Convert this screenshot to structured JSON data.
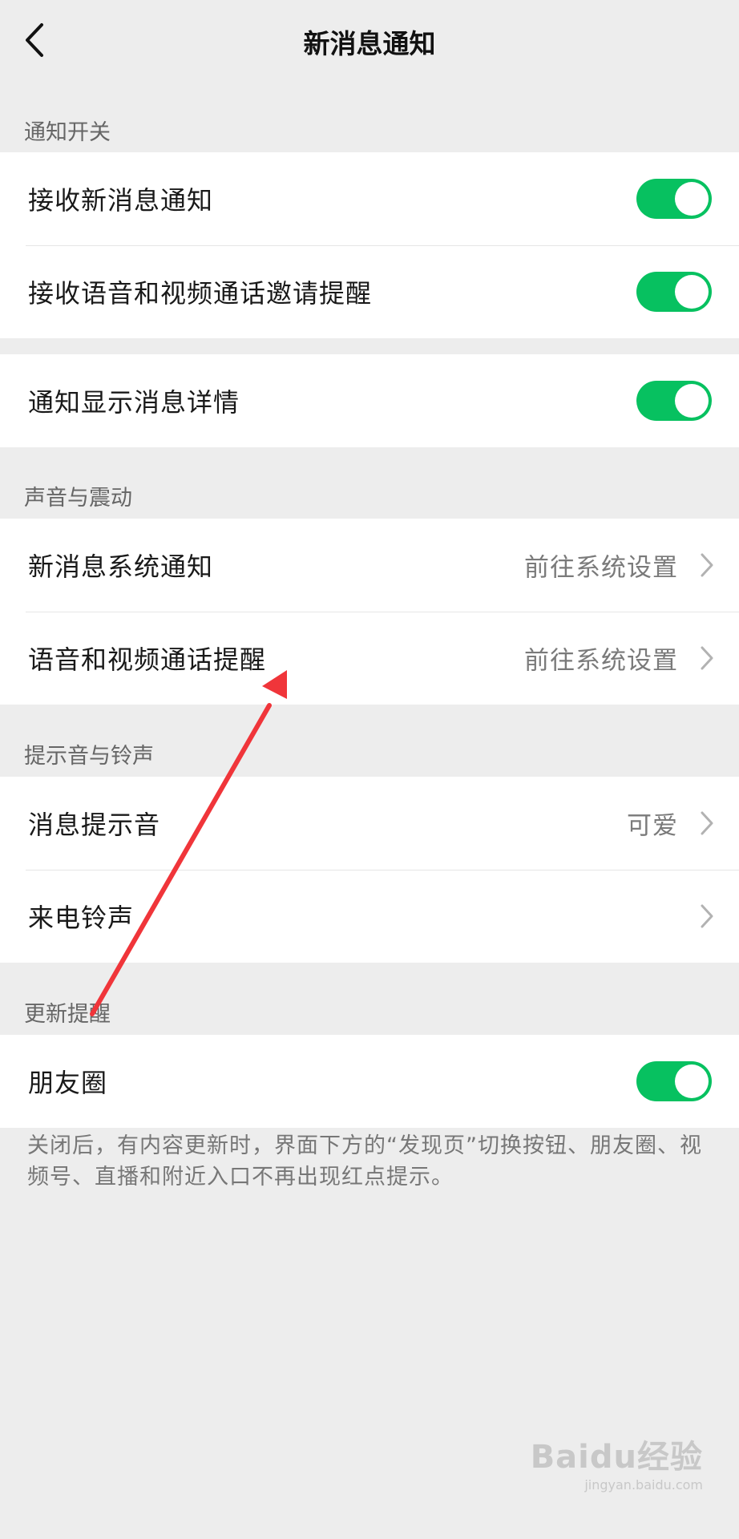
{
  "header": {
    "title": "新消息通知"
  },
  "sections": {
    "notify_switch": "通知开关",
    "sound_vibration": "声音与震动",
    "tone_ringtone": "提示音与铃声",
    "update_reminder": "更新提醒"
  },
  "rows": {
    "receive_new": {
      "label": "接收新消息通知",
      "on": true
    },
    "receive_call": {
      "label": "接收语音和视频通话邀请提醒",
      "on": true
    },
    "show_details": {
      "label": "通知显示消息详情",
      "on": true
    },
    "sys_notify": {
      "label": "新消息系统通知",
      "value": "前往系统设置"
    },
    "call_remind": {
      "label": "语音和视频通话提醒",
      "value": "前往系统设置"
    },
    "msg_tone": {
      "label": "消息提示音",
      "value": "可爱"
    },
    "ringtone": {
      "label": "来电铃声"
    },
    "moments": {
      "label": "朋友圈",
      "on": true
    }
  },
  "footnote": "关闭后，有内容更新时，界面下方的“发现页”切换按钮、朋友圈、视频号、直播和附近入口不再出现红点提示。",
  "watermark": {
    "logo": "Baidu经验",
    "sub": "jingyan.baidu.com"
  },
  "colors": {
    "toggle_on": "#07c160",
    "annotation_arrow": "#f0353a",
    "background": "#ededed"
  }
}
